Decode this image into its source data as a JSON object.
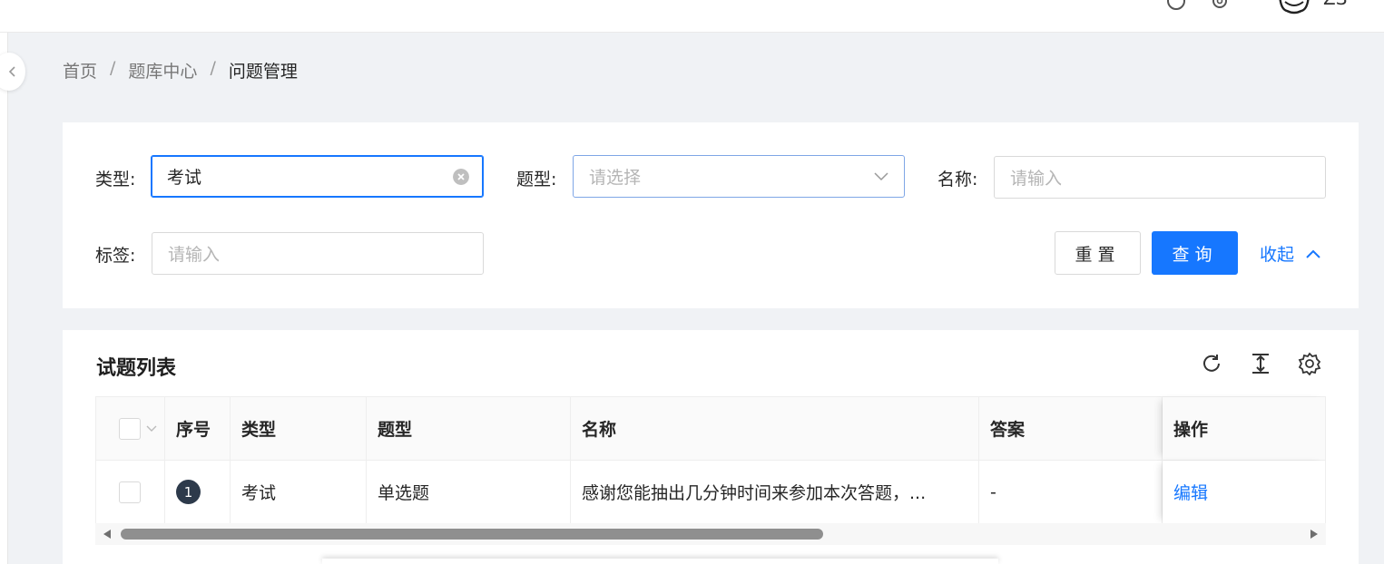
{
  "topbar": {
    "username": "ZS"
  },
  "breadcrumb": {
    "home": "首页",
    "section": "题库中心",
    "current": "问题管理",
    "separator": "/"
  },
  "filters": {
    "type": {
      "label": "类型",
      "value": "考试"
    },
    "question_type": {
      "label": "题型",
      "placeholder": "请选择"
    },
    "name": {
      "label": "名称",
      "placeholder": "请输入"
    },
    "tag": {
      "label": "标签",
      "placeholder": "请输入"
    },
    "colon": ":",
    "reset_label": "重置",
    "query_label": "查询",
    "collapse_label": "收起"
  },
  "table": {
    "title": "试题列表",
    "columns": [
      "序号",
      "类型",
      "题型",
      "名称",
      "答案",
      "操作"
    ],
    "rows": [
      {
        "index": "1",
        "type": "考试",
        "question_type": "单选题",
        "name": "感谢您能抽出几分钟时间来参加本次答题，...",
        "answer": "-",
        "action": "编辑"
      }
    ]
  },
  "colors": {
    "primary": "#1677ff",
    "badge": "#2d3a4b"
  }
}
